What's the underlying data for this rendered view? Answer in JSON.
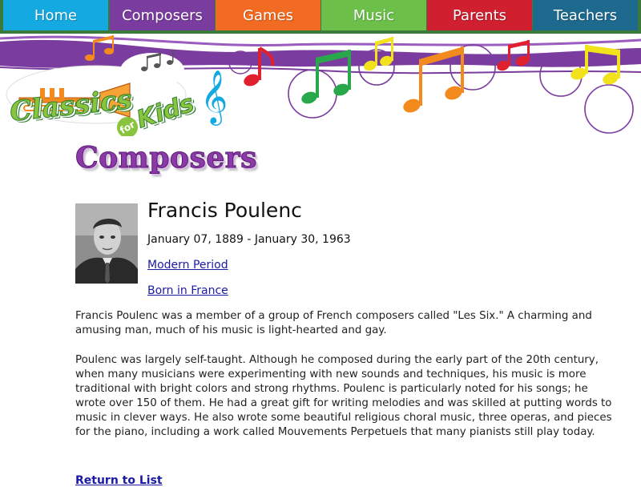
{
  "nav": {
    "items": [
      {
        "label": "Home",
        "color": "#14a9e1"
      },
      {
        "label": "Composers",
        "color": "#7a3c9e"
      },
      {
        "label": "Games",
        "color": "#f26b22"
      },
      {
        "label": "Music",
        "color": "#6cc04a"
      },
      {
        "label": "Parents",
        "color": "#d01f2f"
      },
      {
        "label": "Teachers",
        "color": "#1d6a8e"
      }
    ]
  },
  "logo": {
    "part1": "Classics",
    "part2": "for",
    "part3": "Kids"
  },
  "page": {
    "section_title": "Composers"
  },
  "composer": {
    "name": "Francis Poulenc",
    "dates": "January 07, 1889 - January 30, 1963",
    "period_link": "Modern Period",
    "born_link": "Born in France",
    "paragraphs": [
      "Francis Poulenc was a member of a group of French composers called \"Les Six.\" A charming and amusing man, much of his music is light-hearted and gay.",
      "Poulenc was largely self-taught. Although he composed during the early part of the 20th century, when many musicians were experimenting with new sounds and techniques, his music is more traditional with bright colors and strong rhythms. Poulenc is particularly noted for his songs; he wrote over 150 of them. He had a great gift for writing melodies and was skilled at putting words to music in clever ways. He also wrote some beautiful religious choral music, three operas, and pieces for the piano, including a work called Mouvements Perpetuels that many pianists still play today."
    ]
  },
  "footer": {
    "return_link": "Return to List"
  },
  "colors": {
    "link": "#1a1aa6",
    "title_purple": "#8b3aa7",
    "banner_purple": "#7a3c9e",
    "nav_bar": "#3a7a3a"
  }
}
